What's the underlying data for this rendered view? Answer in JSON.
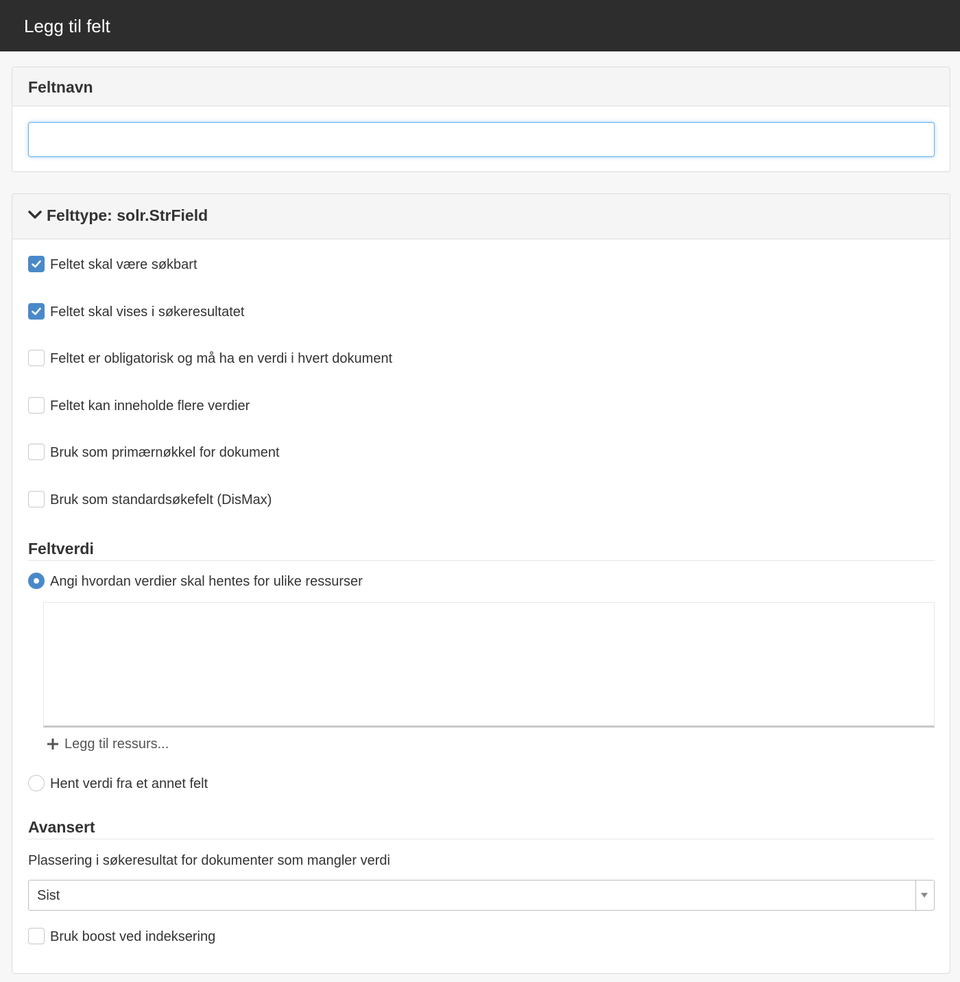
{
  "window": {
    "title": "Legg til felt"
  },
  "name_panel": {
    "heading": "Feltnavn",
    "input_value": "",
    "input_placeholder": ""
  },
  "type_panel": {
    "heading": "Felttype: solr.StrField",
    "options": [
      {
        "label": "Feltet skal være søkbart",
        "checked": true
      },
      {
        "label": "Feltet skal vises i søkeresultatet",
        "checked": true
      },
      {
        "label": "Feltet er obligatorisk og må ha en verdi i hvert dokument",
        "checked": false
      },
      {
        "label": "Feltet kan inneholde flere verdier",
        "checked": false
      },
      {
        "label": "Bruk som primærnøkkel for dokument",
        "checked": false
      },
      {
        "label": "Bruk som standardsøkefelt (DisMax)",
        "checked": false
      }
    ],
    "field_value": {
      "title": "Feltverdi",
      "radio_per_resource": {
        "label": "Angi hvordan verdier skal hentes for ulike ressurser",
        "selected": true
      },
      "add_resource": "Legg til ressurs...",
      "radio_from_field": {
        "label": "Hent verdi fra et annet felt",
        "selected": false
      }
    },
    "advanced": {
      "title": "Avansert",
      "placement_label": "Plassering i søkeresultat for dokumenter som mangler verdi",
      "placement_value": "Sist",
      "boost_label": "Bruk boost ved indeksering",
      "boost_checked": false
    }
  },
  "colors": {
    "titlebar": "#2d2d2d",
    "accent": "#4a89c8",
    "focus": "#66afe9"
  }
}
